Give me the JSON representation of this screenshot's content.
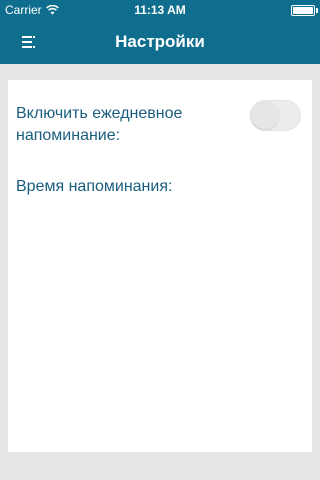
{
  "status_bar": {
    "carrier": "Carrier",
    "time": "11:13 AM",
    "wifi_icon": "wifi-icon",
    "battery_icon": "battery-icon",
    "battery_level": 1.0
  },
  "nav": {
    "title": "Настройки",
    "menu_icon": "menu-icon"
  },
  "settings": {
    "reminder_label": "Включить ежедневное напоминание:",
    "reminder_enabled": false,
    "time_label": "Время напоминания:"
  },
  "colors": {
    "header": "#0f6e8e",
    "accent_text": "#1a5e7f",
    "background": "#e6e6e6",
    "card": "#ffffff"
  }
}
